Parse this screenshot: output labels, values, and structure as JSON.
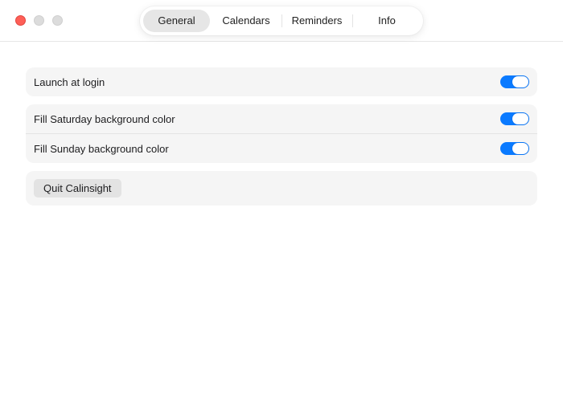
{
  "window": {
    "tabs": [
      {
        "label": "General",
        "active": true
      },
      {
        "label": "Calendars",
        "active": false
      },
      {
        "label": "Reminders",
        "active": false
      },
      {
        "label": "Info",
        "active": false
      }
    ]
  },
  "settings": {
    "launch_group": [
      {
        "label": "Launch at login",
        "enabled": true
      }
    ],
    "background_group": [
      {
        "label": "Fill Saturday background color",
        "enabled": true
      },
      {
        "label": "Fill Sunday background color",
        "enabled": true
      }
    ],
    "quit_button_label": "Quit Calinsight"
  },
  "colors": {
    "accent": "#0a7aff",
    "close": "#fe5f57",
    "inactive_traffic": "#dcdcdc",
    "group_background": "#f5f5f5"
  },
  "icons": [
    "close-icon",
    "minimize-icon",
    "zoom-icon"
  ]
}
